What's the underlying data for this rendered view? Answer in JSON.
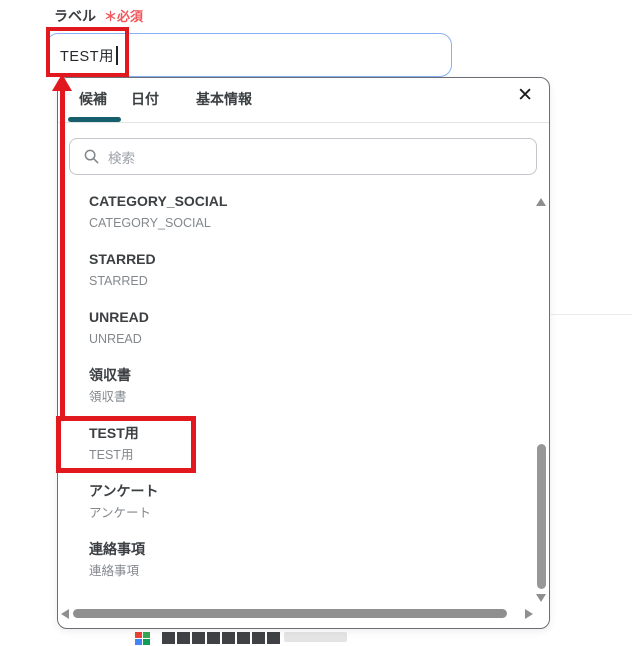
{
  "form": {
    "label": "ラベル",
    "required": "＊必須",
    "input_value": "TEST用"
  },
  "popup": {
    "tabs": [
      {
        "label": "候補",
        "active": true
      },
      {
        "label": "日付",
        "active": false
      },
      {
        "label": "基本情報",
        "active": false
      }
    ],
    "close_glyph": "✕",
    "search": {
      "placeholder": "検索",
      "icon": "magnifier"
    },
    "items": [
      {
        "title": "CATEGORY_SOCIAL",
        "subtitle": "CATEGORY_SOCIAL",
        "highlighted": false
      },
      {
        "title": "STARRED",
        "subtitle": "STARRED",
        "highlighted": false
      },
      {
        "title": "UNREAD",
        "subtitle": "UNREAD",
        "highlighted": false
      },
      {
        "title": "領収書",
        "subtitle": "領収書",
        "highlighted": false
      },
      {
        "title": "TEST用",
        "subtitle": "TEST用",
        "highlighted": true
      },
      {
        "title": "アンケート",
        "subtitle": "アンケート",
        "highlighted": false
      },
      {
        "title": "連絡事項",
        "subtitle": "連絡事項",
        "highlighted": false
      }
    ],
    "scrollbars": {
      "vertical": true,
      "horizontal": true
    }
  },
  "annotations": {
    "color": "#e1181e",
    "boxed_input_text": "TEST用",
    "boxed_list_item": "TEST用",
    "arrow": "from list item TEST用 up to input field"
  },
  "colors": {
    "required_red": "#f1575c",
    "annotation_red": "#e1181e",
    "active_tab_underline": "#185f6d",
    "input_border_blue": "#89b0f6",
    "popup_border": "#6b6f73",
    "title_text": "#3c4043",
    "subtitle_text": "#83888d",
    "placeholder_text": "#9aa0a6",
    "scrollbar_gray": "#979797"
  }
}
